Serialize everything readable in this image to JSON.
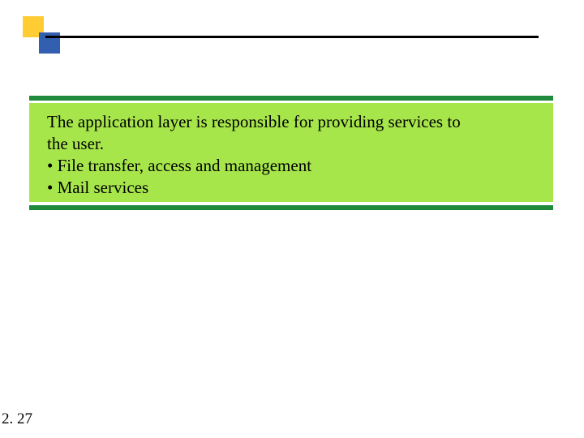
{
  "content": {
    "line1": "The application layer is responsible for providing services to",
    "line2": "the user.",
    "bullet1": "• File transfer, access and management",
    "bullet2": "• Mail services"
  },
  "page_number": "2. 27"
}
